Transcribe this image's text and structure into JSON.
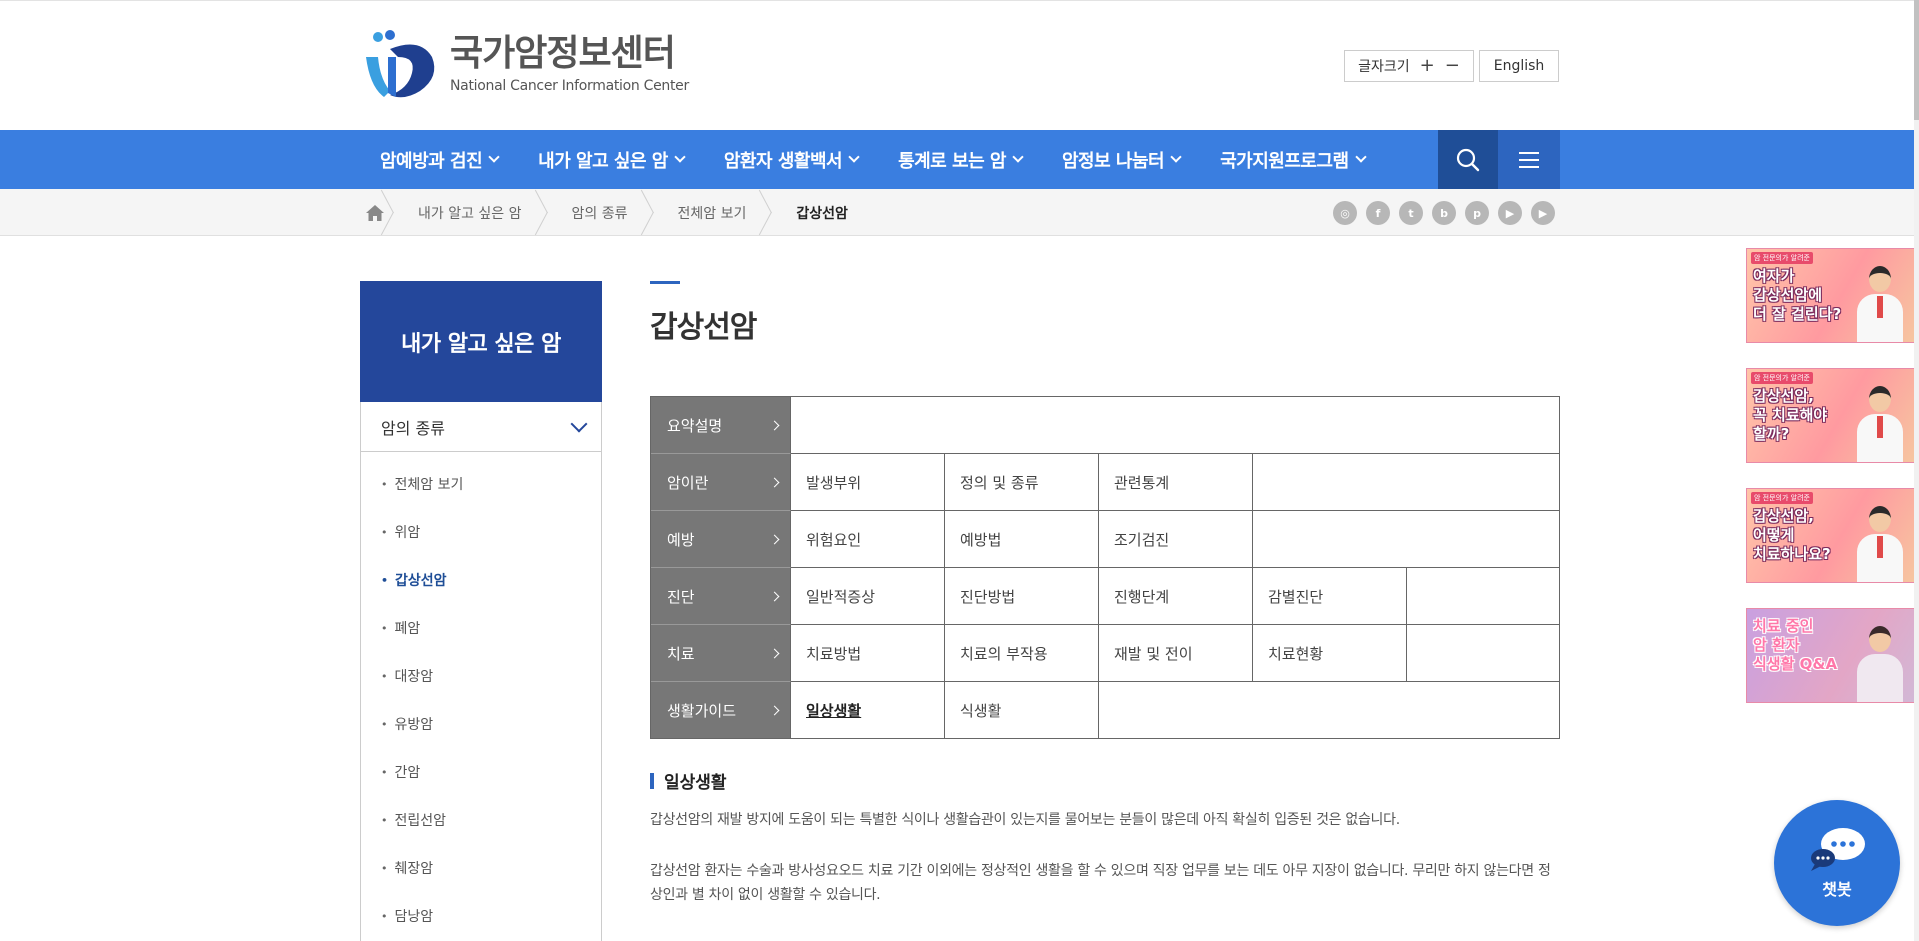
{
  "logo": {
    "title_ko": "국가암정보센터",
    "title_en": "National Cancer Information Center"
  },
  "utility": {
    "font_size_label": "글자크기",
    "increase": "+",
    "decrease": "−",
    "language": "English"
  },
  "gnb": {
    "items": [
      {
        "label": "암예방과 검진"
      },
      {
        "label": "내가 알고 싶은 암"
      },
      {
        "label": "암환자 생활백서"
      },
      {
        "label": "통계로 보는 암"
      },
      {
        "label": "암정보 나눔터"
      },
      {
        "label": "국가지원프로그램"
      }
    ],
    "search_icon": "search-icon",
    "menu_icon": "hamburger-menu-icon"
  },
  "breadcrumb": {
    "home_icon": "home-icon",
    "items": [
      "내가 알고 싶은 암",
      "암의 종류",
      "전체암 보기",
      "갑상선암"
    ]
  },
  "sns": [
    "instagram-icon",
    "facebook-icon",
    "twitter-icon",
    "blog-icon",
    "post-icon",
    "naver-tv-icon",
    "youtube-icon"
  ],
  "lnb": {
    "title": "내가 알고 싶은 암",
    "sub_title": "암의 종류",
    "items": [
      "전체암 보기",
      "위암",
      "갑상선암",
      "폐암",
      "대장암",
      "유방암",
      "간암",
      "전립선암",
      "췌장암",
      "담낭암"
    ],
    "active_index": 2
  },
  "content": {
    "title": "갑상선암",
    "tabs": [
      {
        "head": "요약설명",
        "cells": []
      },
      {
        "head": "암이란",
        "cells": [
          "발생부위",
          "정의 및 종류",
          "관련통계"
        ]
      },
      {
        "head": "예방",
        "cells": [
          "위험요인",
          "예방법",
          "조기검진"
        ]
      },
      {
        "head": "진단",
        "cells": [
          "일반적증상",
          "진단방법",
          "진행단계",
          "감별진단"
        ]
      },
      {
        "head": "치료",
        "cells": [
          "치료방법",
          "치료의 부작용",
          "재발 및 전이",
          "치료현황"
        ]
      },
      {
        "head": "생활가이드",
        "cells": [
          "일상생활",
          "식생활"
        ]
      }
    ],
    "selected_cell": "일상생활",
    "section_title": "일상생활",
    "paragraphs": [
      "갑상선암의 재발 방지에 도움이 되는 특별한 식이나 생활습관이 있는지를 물어보는 분들이 많은데 아직 확실히 입증된 것은 없습니다.",
      "갑상선암 환자는 수술과 방사성요오드 치료 기간 이외에는 정상적인 생활을 할 수 있으며 직장 업무를 보는 데도 아무 지장이 없습니다. 무리만 하지 않는다면 정상인과 별 차이 없이 생활할 수 있습니다."
    ]
  },
  "banners": [
    {
      "tag": "암 전문의가 알려준",
      "text": "여자가\n갑상선암에\n더 잘 걸린다?"
    },
    {
      "tag": "암 전문의가 알려준",
      "text": "갑상선암,\n꼭 치료해야\n할까?"
    },
    {
      "tag": "암 전문의가 알려준",
      "text": "갑상선암,\n어떻게\n치료하나요?"
    },
    {
      "tag": "",
      "text": "치료 중인\n암 환자\n식생활 Q&A"
    }
  ],
  "chatbot": {
    "label": "챗봇",
    "icon": "chat-bubble-icon"
  },
  "colors": {
    "gnb": "#3a7ee0",
    "lnb_title": "#24479b",
    "tab_head": "#777777",
    "chatbot": "#2c73d8"
  }
}
